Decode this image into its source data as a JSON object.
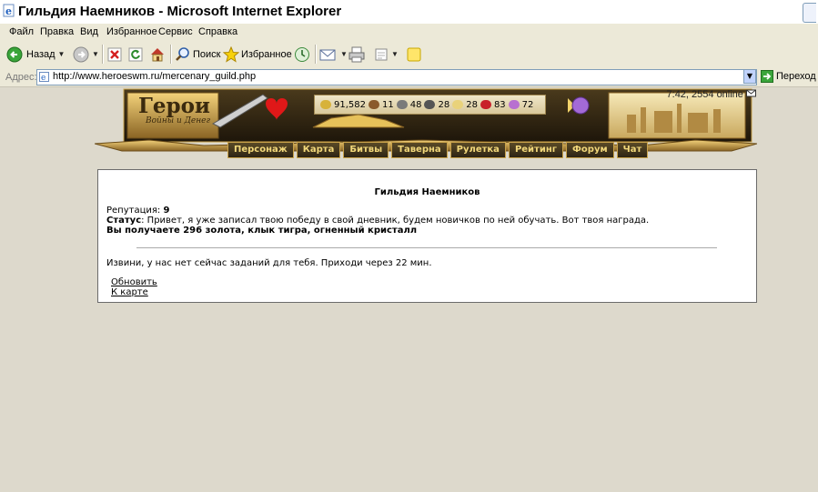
{
  "window": {
    "title": "Гильдия Наемников - Microsoft Internet Explorer"
  },
  "menu": [
    "Файл",
    "Правка",
    "Вид",
    "Избранное",
    "Сервис",
    "Справка"
  ],
  "toolbar": {
    "back_label": "Назад",
    "search_label": "Поиск",
    "favorites_label": "Избранное"
  },
  "address": {
    "label": "Адрес:",
    "url": "http://www.heroeswm.ru/mercenary_guild.php",
    "go_label": "Переход"
  },
  "header": {
    "logo_text": "Герои",
    "logo_subtitle": "Войны и Денег",
    "online_status": "7:42, 2554 online",
    "resources": [
      "91,582",
      "11",
      "48",
      "28",
      "28",
      "83",
      "72"
    ],
    "nav": [
      "Персонаж",
      "Карта",
      "Битвы",
      "Таверна",
      "Рулетка",
      "Рейтинг",
      "Форум",
      "Чат"
    ]
  },
  "guild": {
    "title": "Гильдия Наемников",
    "reputation_label": "Репутация:",
    "reputation_value": "9",
    "status_label": "Статус",
    "status_text": ": Привет, я уже записал твою победу в свой дневник, будем новичков по ней обучать. Вот твоя награда.",
    "reward_text": "Вы получаете 296 золота, клык тигра, огненный кристалл",
    "no_tasks_text": "Извини, у нас нет сейчас заданий для тебя. Приходи через 22 мин.",
    "refresh_link": "Обновить",
    "map_link": "К карте"
  },
  "colors": {
    "page_bg": "#ddd9cc",
    "nav_text": "#f1d77a",
    "panel_border": "#6b6b6b"
  }
}
